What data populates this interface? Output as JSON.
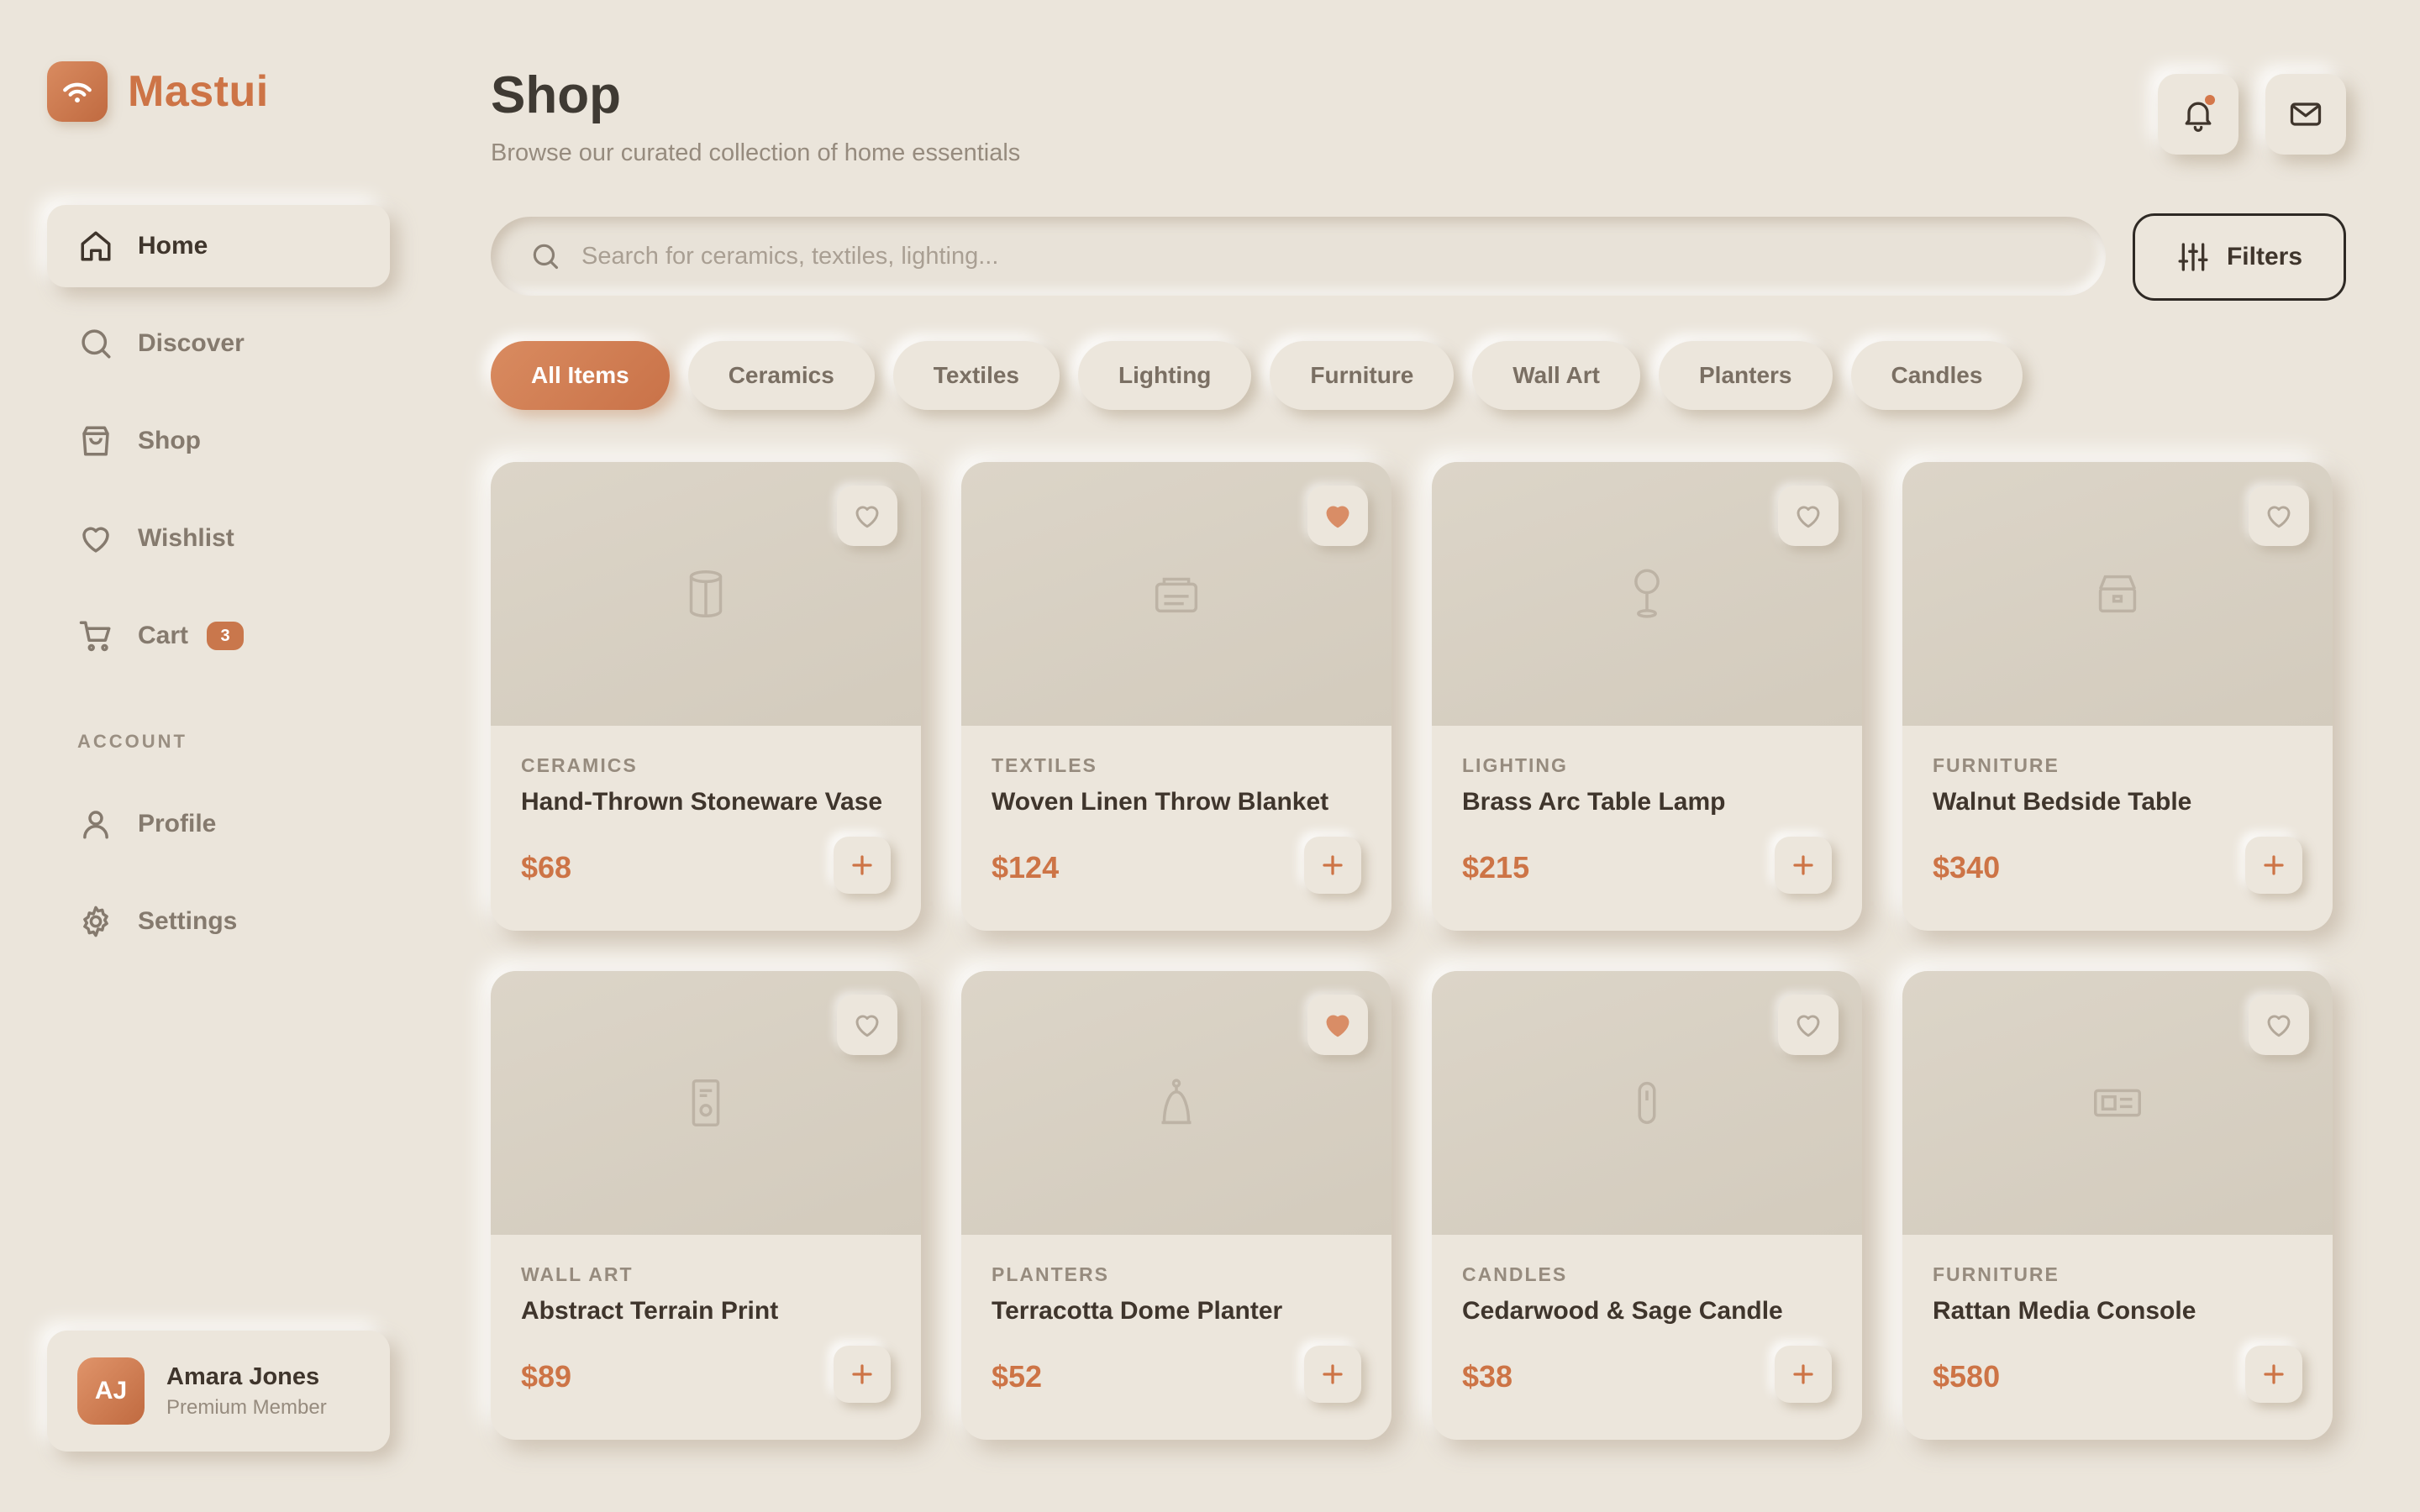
{
  "brand": {
    "name": "Mastui",
    "icon": "broadcast-icon"
  },
  "sidebar": {
    "nav": [
      {
        "label": "Home",
        "icon": "home-icon",
        "active": true
      },
      {
        "label": "Discover",
        "icon": "search-icon"
      },
      {
        "label": "Shop",
        "icon": "shopping-bag-icon"
      },
      {
        "label": "Wishlist",
        "icon": "heart-icon"
      },
      {
        "label": "Cart",
        "icon": "cart-icon",
        "badge": "3"
      }
    ],
    "account_label": "ACCOUNT",
    "account": [
      {
        "label": "Profile",
        "icon": "user-icon"
      },
      {
        "label": "Settings",
        "icon": "gear-icon"
      }
    ],
    "user": {
      "initials": "AJ",
      "name": "Amara Jones",
      "role": "Premium Member"
    }
  },
  "header": {
    "title": "Shop",
    "subtitle": "Browse our curated collection of home essentials",
    "notifications_icon": "bell-icon",
    "messages_icon": "mail-icon"
  },
  "search": {
    "placeholder": "Search for ceramics, textiles, lighting...",
    "value": ""
  },
  "filters": {
    "label": "Filters",
    "icon": "sliders-icon"
  },
  "categories": [
    {
      "label": "All Items",
      "active": true
    },
    {
      "label": "Ceramics"
    },
    {
      "label": "Textiles"
    },
    {
      "label": "Lighting"
    },
    {
      "label": "Furniture"
    },
    {
      "label": "Wall Art"
    },
    {
      "label": "Planters"
    },
    {
      "label": "Candles"
    }
  ],
  "products": [
    {
      "category": "CERAMICS",
      "name": "Hand-Thrown Stoneware Vase",
      "price": "$68",
      "favorite": false,
      "icon": "vase-icon"
    },
    {
      "category": "TEXTILES",
      "name": "Woven Linen Throw Blanket",
      "price": "$124",
      "favorite": true,
      "icon": "blanket-icon"
    },
    {
      "category": "LIGHTING",
      "name": "Brass Arc Table Lamp",
      "price": "$215",
      "favorite": false,
      "icon": "lamp-icon"
    },
    {
      "category": "FURNITURE",
      "name": "Walnut Bedside Table",
      "price": "$340",
      "favorite": false,
      "icon": "nightstand-icon"
    },
    {
      "category": "WALL ART",
      "name": "Abstract Terrain Print",
      "price": "$89",
      "favorite": false,
      "icon": "frame-icon"
    },
    {
      "category": "PLANTERS",
      "name": "Terracotta Dome Planter",
      "price": "$52",
      "favorite": true,
      "icon": "planter-icon"
    },
    {
      "category": "CANDLES",
      "name": "Cedarwood & Sage Candle",
      "price": "$38",
      "favorite": false,
      "icon": "candle-icon"
    },
    {
      "category": "FURNITURE",
      "name": "Rattan Media Console",
      "price": "$580",
      "favorite": false,
      "icon": "console-icon"
    }
  ],
  "colors": {
    "background": "#ebe5db",
    "accent": "#cd7446",
    "text_dark": "#3f352c",
    "text_muted": "#968b7e"
  }
}
